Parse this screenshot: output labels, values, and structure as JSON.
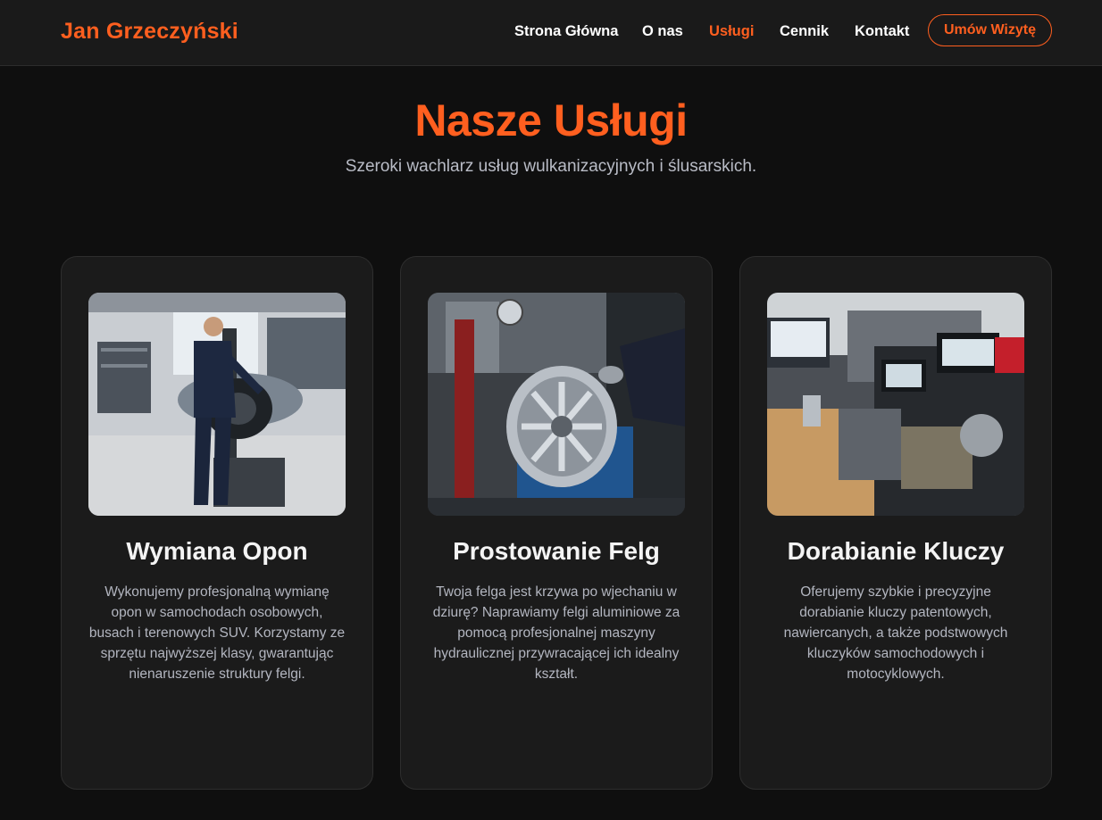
{
  "brand": {
    "name": "Jan Grzeczyński",
    "accent": "#ff5f1f"
  },
  "nav": {
    "items": [
      {
        "label": "Strona Główna",
        "active": false
      },
      {
        "label": "O nas",
        "active": false
      },
      {
        "label": "Usługi",
        "active": true
      },
      {
        "label": "Cennik",
        "active": false
      },
      {
        "label": "Kontakt",
        "active": false
      }
    ],
    "cta_label": "Umów Wizytę"
  },
  "hero": {
    "title": "Nasze Usługi",
    "subtitle": "Szeroki wachlarz usług wulkanizacyjnych i ślusarskich."
  },
  "services": [
    {
      "title": "Wymiana Opon",
      "description": "Wykonujemy profesjonalną wymianę opon w samochodach osobowych, busach i terenowych SUV. Korzystamy ze sprzętu najwyższej klasy, gwarantując nienaruszenie struktury felgi.",
      "image": "tire-change-photo"
    },
    {
      "title": "Prostowanie Felg",
      "description": "Twoja felga jest krzywa po wjechaniu w dziurę? Naprawiamy felgi aluminiowe za pomocą profesjonalnej maszyny hydraulicznej przywracającej ich idealny kształt.",
      "image": "rim-straightening-photo"
    },
    {
      "title": "Dorabianie Kluczy",
      "description": "Oferujemy szybkie i precyzyjne dorabianie kluczy patentowych, nawiercanych, a także podstwowych kluczyków samochodowych i motocyklowych.",
      "image": "key-cutting-photo"
    }
  ]
}
